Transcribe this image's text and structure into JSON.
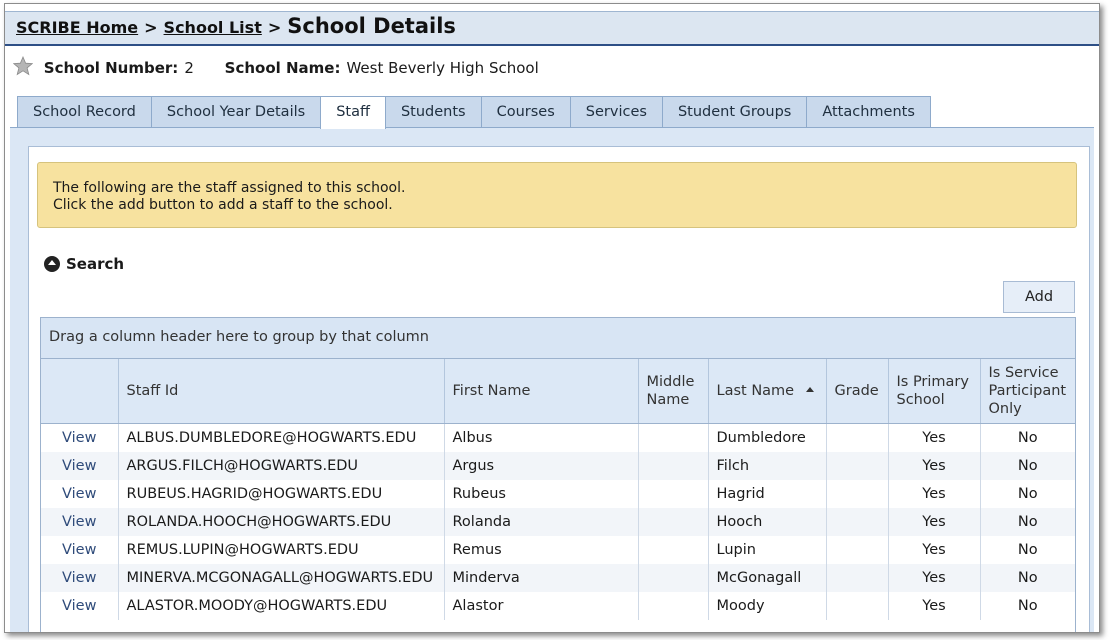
{
  "breadcrumb": {
    "home": "SCRIBE Home",
    "sep1": ">",
    "school_list": "School List",
    "sep2": ">",
    "current": "School Details"
  },
  "school": {
    "number_label": "School Number:",
    "number_value": "2",
    "name_label": "School Name:",
    "name_value": "West Beverly High School"
  },
  "tabs": [
    {
      "label": "School Record"
    },
    {
      "label": "School Year Details"
    },
    {
      "label": "Staff",
      "active": true
    },
    {
      "label": "Students"
    },
    {
      "label": "Courses"
    },
    {
      "label": "Services"
    },
    {
      "label": "Student Groups"
    },
    {
      "label": "Attachments"
    }
  ],
  "notice": {
    "line1": "The following are the staff assigned to this school.",
    "line2": "Click the add button to add a staff to the school."
  },
  "search_label": "Search",
  "add_label": "Add",
  "grid": {
    "group_hint": "Drag a column header here to group by that column",
    "columns": [
      "",
      "Staff Id",
      "First Name",
      "Middle Name",
      "Last Name",
      "Grade",
      "Is Primary School",
      "Is Service Participant Only"
    ],
    "rows": [
      {
        "action": "View",
        "staff_id": "ALBUS.DUMBLEDORE@HOGWARTS.EDU",
        "first": "Albus",
        "middle": "",
        "last": "Dumbledore",
        "grade": "",
        "primary": "Yes",
        "service": "No"
      },
      {
        "action": "View",
        "staff_id": "ARGUS.FILCH@HOGWARTS.EDU",
        "first": "Argus",
        "middle": "",
        "last": "Filch",
        "grade": "",
        "primary": "Yes",
        "service": "No"
      },
      {
        "action": "View",
        "staff_id": "RUBEUS.HAGRID@HOGWARTS.EDU",
        "first": "Rubeus",
        "middle": "",
        "last": "Hagrid",
        "grade": "",
        "primary": "Yes",
        "service": "No"
      },
      {
        "action": "View",
        "staff_id": "ROLANDA.HOOCH@HOGWARTS.EDU",
        "first": "Rolanda",
        "middle": "",
        "last": "Hooch",
        "grade": "",
        "primary": "Yes",
        "service": "No"
      },
      {
        "action": "View",
        "staff_id": "REMUS.LUPIN@HOGWARTS.EDU",
        "first": "Remus",
        "middle": "",
        "last": "Lupin",
        "grade": "",
        "primary": "Yes",
        "service": "No"
      },
      {
        "action": "View",
        "staff_id": "MINERVA.MCGONAGALL@HOGWARTS.EDU",
        "first": "Minderva",
        "middle": "",
        "last": "McGonagall",
        "grade": "",
        "primary": "Yes",
        "service": "No"
      },
      {
        "action": "View",
        "staff_id": "ALASTOR.MOODY@HOGWARTS.EDU",
        "first": "Alastor",
        "middle": "",
        "last": "Moody",
        "grade": "",
        "primary": "Yes",
        "service": "No"
      }
    ]
  }
}
